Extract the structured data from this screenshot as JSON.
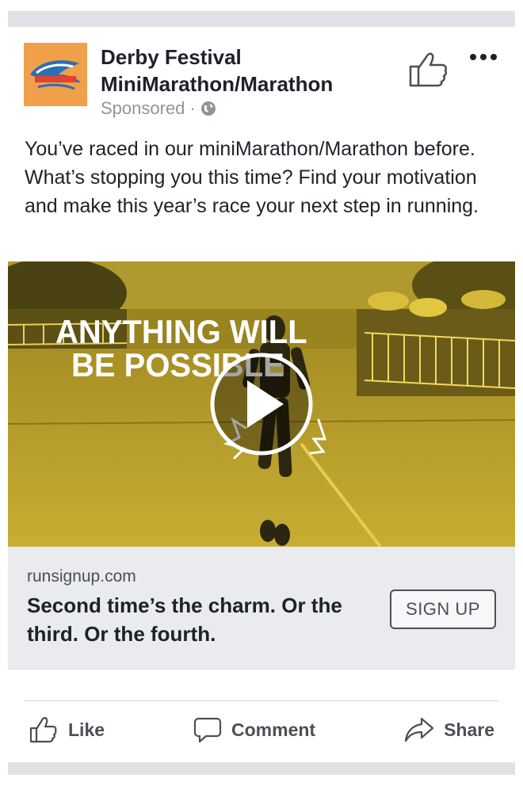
{
  "post": {
    "page_name": "Derby Festival MiniMarathon/Marathon",
    "sponsored": "Sponsored ·",
    "text": "You’ve raced in our miniMarathon/Marathon before. What’s stopping you this time? Find your motivation and make this year’s race your next step in running."
  },
  "video": {
    "overlay_line1": "ANYTHING WILL",
    "overlay_line2": "BE POSSIBLE",
    "play_icon": "play-icon",
    "tint_color": "#c9ad2e"
  },
  "link": {
    "domain": "runsignup.com",
    "headline": "Second time’s the charm. Or the third. Or the fourth.",
    "cta_label": "SIGN UP"
  },
  "actions": {
    "like": "Like",
    "comment": "Comment",
    "share": "Share"
  },
  "icons": {
    "globe": "globe-icon",
    "thumbs_up": "thumbs-up-icon",
    "more": "more-options-icon"
  }
}
